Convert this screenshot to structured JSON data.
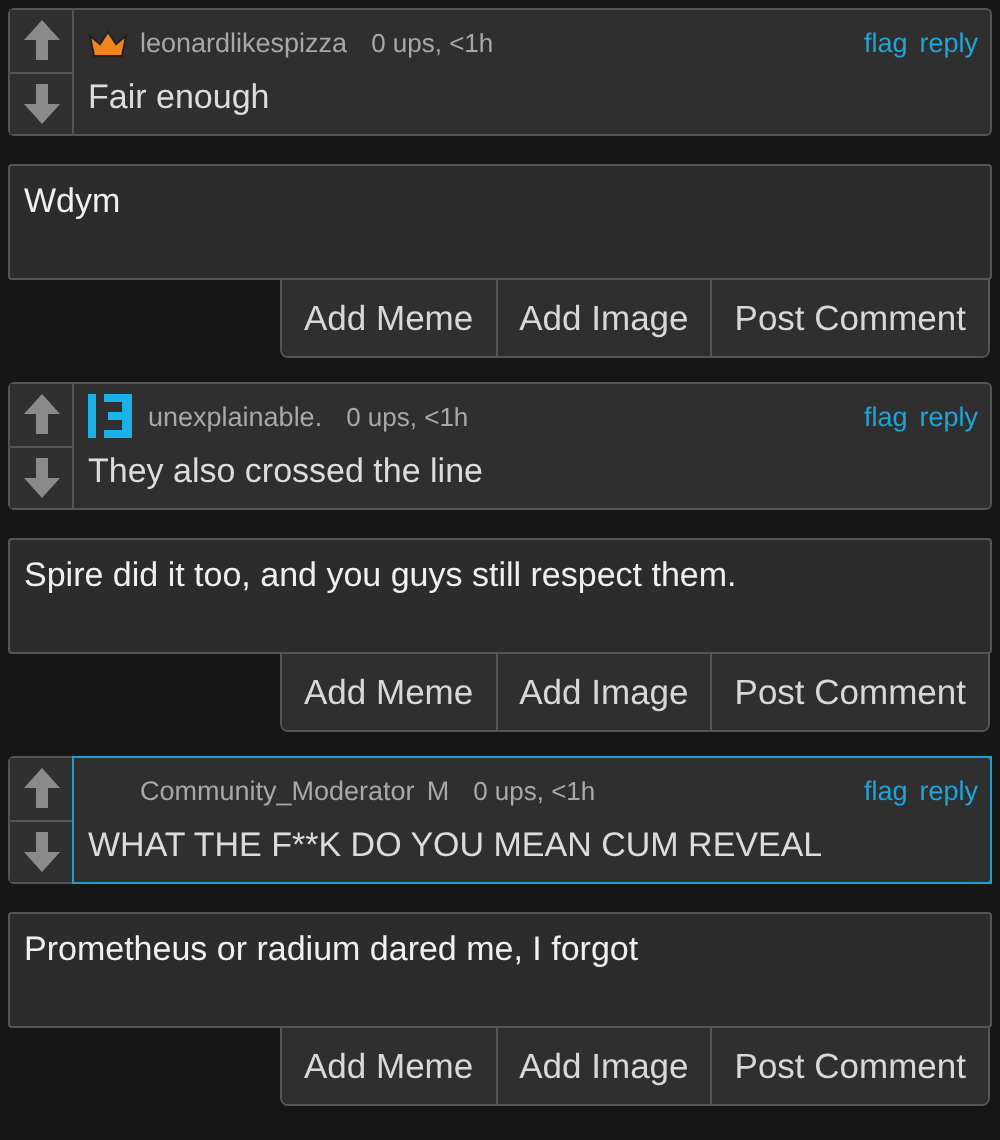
{
  "threads": [
    {
      "comment": {
        "kind": "crown",
        "username": "leonardlikespizza",
        "meta": "0 ups, <1h",
        "flag": "flag",
        "reply": "reply",
        "text": "Fair enough",
        "highlighted": false
      },
      "reply_value": "Wdym",
      "buttons": [
        "Add Meme",
        "Add Image",
        "Post Comment"
      ]
    },
    {
      "comment": {
        "kind": "logo",
        "username": "unexplainable.",
        "meta": "0 ups, <1h",
        "flag": "flag",
        "reply": "reply",
        "text": "They also crossed the line",
        "highlighted": false
      },
      "reply_value": "Spire did it too, and you guys still respect them.",
      "buttons": [
        "Add Meme",
        "Add Image",
        "Post Comment"
      ]
    },
    {
      "comment": {
        "kind": "moderator",
        "username": "Community_Moderator",
        "mod_tag": "M",
        "meta": "0 ups, <1h",
        "flag": "flag",
        "reply": "reply",
        "text": "WHAT THE F**K DO YOU MEAN CUM REVEAL",
        "highlighted": true
      },
      "reply_value": "Prometheus or radium dared me, I forgot",
      "buttons": [
        "Add Meme",
        "Add Image",
        "Post Comment"
      ]
    }
  ]
}
